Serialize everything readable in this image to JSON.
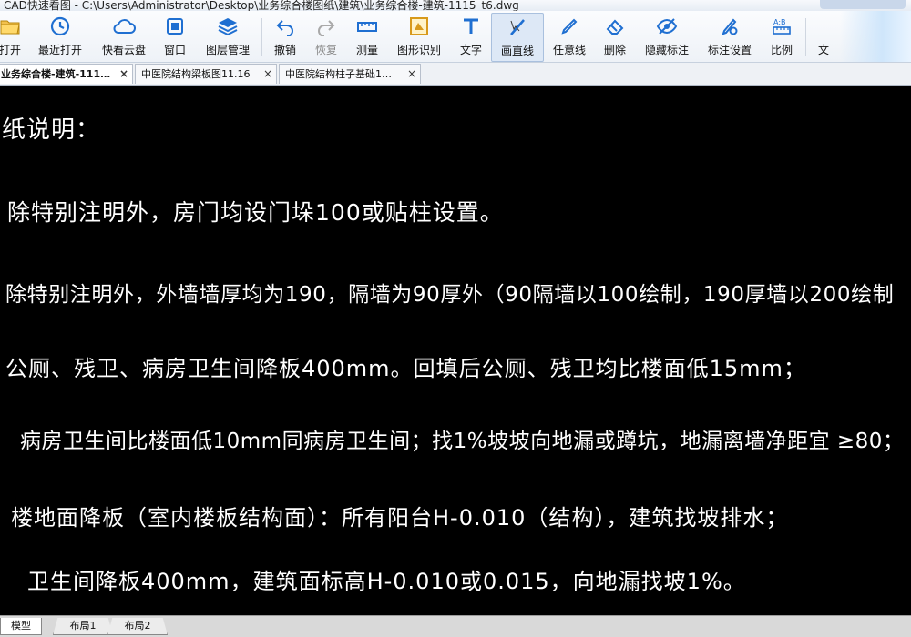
{
  "window": {
    "title": "CAD快速看图 - C:\\Users\\Administrator\\Desktop\\业务综合楼图纸\\建筑\\业务综合楼-建筑-1115_t6.dwg"
  },
  "toolbar": {
    "items": [
      {
        "label": "打开",
        "icon": "folder-open-icon"
      },
      {
        "label": "最近打开",
        "icon": "clock-icon"
      },
      {
        "label": "快看云盘",
        "icon": "cloud-icon"
      },
      {
        "label": "窗口",
        "icon": "window-icon"
      },
      {
        "label": "图层管理",
        "icon": "layers-icon"
      },
      {
        "label": "撤销",
        "icon": "undo-icon"
      },
      {
        "label": "恢复",
        "icon": "redo-icon"
      },
      {
        "label": "测量",
        "icon": "ruler-icon"
      },
      {
        "label": "图形识别",
        "icon": "shape-recognize-icon"
      },
      {
        "label": "文字",
        "icon": "text-icon"
      },
      {
        "label": "画直线",
        "icon": "line-icon"
      },
      {
        "label": "任意线",
        "icon": "pen-icon"
      },
      {
        "label": "删除",
        "icon": "eraser-icon"
      },
      {
        "label": "隐藏标注",
        "icon": "eye-hide-icon"
      },
      {
        "label": "标注设置",
        "icon": "settings-icon"
      },
      {
        "label": "比例",
        "icon": "scale-icon"
      },
      {
        "label": "文",
        "icon": "text-more-icon"
      }
    ]
  },
  "tabs": [
    {
      "label": "业务综合楼-建筑-111…"
    },
    {
      "label": "中医院结构梁板图11.16"
    },
    {
      "label": "中医院结构柱子基础1…"
    }
  ],
  "drawing": {
    "lines": [
      "纸说明：",
      "除特别注明外，房门均设门垛100或贴柱设置。",
      "除特别注明外，外墙墙厚均为190，隔墙为90厚外（90隔墙以100绘制，190厚墙以200绘制",
      "公厕、残卫、病房卫生间降板400mm。回填后公厕、残卫均比楼面低15mm；",
      "病房卫生间比楼面低10mm同病房卫生间；找1%坡坡向地漏或蹲坑，地漏离墙净距宜 ≥80；",
      "楼地面降板（室内楼板结构面）：所有阳台H-0.010（结构），建筑找坡排水；",
      "卫生间降板400mm，建筑面标高H-0.010或0.015，向地漏找坡1%。"
    ]
  },
  "layout_tabs": [
    "模型",
    "布局1",
    "布局2"
  ],
  "colors": {
    "canvas_bg": "#000000",
    "text": "#ffffff",
    "accent": "#1f6fd1"
  }
}
